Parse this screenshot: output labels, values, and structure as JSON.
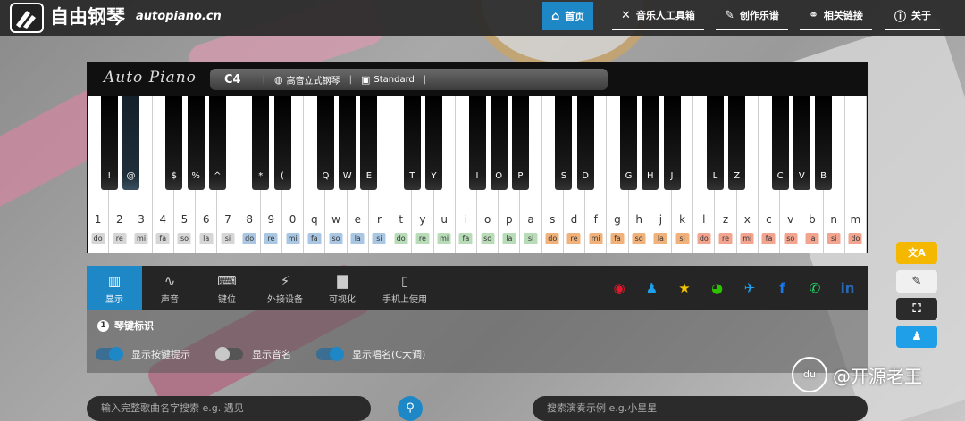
{
  "header": {
    "title": "自由钢琴",
    "domain": "autopiano.cn",
    "nav": [
      {
        "label": "首页",
        "icon": "home-icon",
        "active": true
      },
      {
        "label": "音乐人工具箱",
        "icon": "tools-icon",
        "active": false
      },
      {
        "label": "创作乐谱",
        "icon": "pen-icon",
        "active": false
      },
      {
        "label": "相关链接",
        "icon": "link-icon",
        "active": false
      },
      {
        "label": "关于",
        "icon": "info-icon",
        "active": false
      }
    ]
  },
  "piano": {
    "logo": "Auto Piano",
    "octave": "C4",
    "instrument": "高音立式钢琴",
    "layout": "Standard",
    "sep": "|",
    "white_keys": [
      {
        "key": "1",
        "sol": "do"
      },
      {
        "key": "2",
        "sol": "re"
      },
      {
        "key": "3",
        "sol": "mi"
      },
      {
        "key": "4",
        "sol": "fa"
      },
      {
        "key": "5",
        "sol": "so"
      },
      {
        "key": "6",
        "sol": "la"
      },
      {
        "key": "7",
        "sol": "si"
      },
      {
        "key": "8",
        "sol": "do"
      },
      {
        "key": "9",
        "sol": "re"
      },
      {
        "key": "0",
        "sol": "mi"
      },
      {
        "key": "q",
        "sol": "fa"
      },
      {
        "key": "w",
        "sol": "so"
      },
      {
        "key": "e",
        "sol": "la"
      },
      {
        "key": "r",
        "sol": "si"
      },
      {
        "key": "t",
        "sol": "do"
      },
      {
        "key": "y",
        "sol": "re"
      },
      {
        "key": "u",
        "sol": "mi"
      },
      {
        "key": "i",
        "sol": "fa"
      },
      {
        "key": "o",
        "sol": "so"
      },
      {
        "key": "p",
        "sol": "la"
      },
      {
        "key": "a",
        "sol": "si"
      },
      {
        "key": "s",
        "sol": "do"
      },
      {
        "key": "d",
        "sol": "re"
      },
      {
        "key": "f",
        "sol": "mi"
      },
      {
        "key": "g",
        "sol": "fa"
      },
      {
        "key": "h",
        "sol": "so"
      },
      {
        "key": "j",
        "sol": "la"
      },
      {
        "key": "k",
        "sol": "si"
      },
      {
        "key": "l",
        "sol": "do"
      },
      {
        "key": "z",
        "sol": "re"
      },
      {
        "key": "x",
        "sol": "mi"
      },
      {
        "key": "c",
        "sol": "fa"
      },
      {
        "key": "v",
        "sol": "so"
      },
      {
        "key": "b",
        "sol": "la"
      },
      {
        "key": "n",
        "sol": "si"
      },
      {
        "key": "m",
        "sol": "do"
      }
    ],
    "black_keys": [
      {
        "label": "!",
        "after": 0
      },
      {
        "label": "@",
        "after": 1,
        "pressed": true
      },
      {
        "label": "$",
        "after": 3
      },
      {
        "label": "%",
        "after": 4
      },
      {
        "label": "^",
        "after": 5
      },
      {
        "label": "*",
        "after": 7
      },
      {
        "label": "(",
        "after": 8
      },
      {
        "label": "Q",
        "after": 10
      },
      {
        "label": "W",
        "after": 11
      },
      {
        "label": "E",
        "after": 12
      },
      {
        "label": "T",
        "after": 14
      },
      {
        "label": "Y",
        "after": 15
      },
      {
        "label": "I",
        "after": 17
      },
      {
        "label": "O",
        "after": 18
      },
      {
        "label": "P",
        "after": 19
      },
      {
        "label": "S",
        "after": 21
      },
      {
        "label": "D",
        "after": 22
      },
      {
        "label": "G",
        "after": 24
      },
      {
        "label": "H",
        "after": 25
      },
      {
        "label": "J",
        "after": 26
      },
      {
        "label": "L",
        "after": 28
      },
      {
        "label": "Z",
        "after": 29
      },
      {
        "label": "C",
        "after": 31
      },
      {
        "label": "V",
        "after": 32
      },
      {
        "label": "B",
        "after": 33
      }
    ],
    "group_colors": [
      "#d6d6d6",
      "#a9c6e2",
      "#b8dcb8",
      "#f0b27a",
      "#f2a48f"
    ]
  },
  "toolbar": {
    "tabs": [
      {
        "label": "显示",
        "icon": "piano-icon",
        "active": true
      },
      {
        "label": "声音",
        "icon": "wave-icon",
        "active": false
      },
      {
        "label": "键位",
        "icon": "keyboard-icon",
        "active": false
      },
      {
        "label": "外接设备",
        "icon": "plug-icon",
        "active": false
      },
      {
        "label": "可视化",
        "icon": "bar-chart-icon",
        "active": false
      },
      {
        "label": "手机上使用",
        "icon": "phone-icon",
        "active": false
      }
    ],
    "social": [
      {
        "name": "weibo-icon",
        "glyph": "◉",
        "color": "#e6162d"
      },
      {
        "name": "qq-icon",
        "glyph": "♟",
        "color": "#1e9fe8"
      },
      {
        "name": "qzone-icon",
        "glyph": "★",
        "color": "#f5c400"
      },
      {
        "name": "wechat-icon",
        "glyph": "◕",
        "color": "#2dc100"
      },
      {
        "name": "twitter-icon",
        "glyph": "✈",
        "color": "#1da1f2"
      },
      {
        "name": "facebook-icon",
        "glyph": "f",
        "color": "#1877f2"
      },
      {
        "name": "whatsapp-icon",
        "glyph": "✆",
        "color": "#25d366"
      },
      {
        "name": "linkedin-icon",
        "glyph": "in",
        "color": "#2867b2"
      }
    ]
  },
  "settings": {
    "section_num": "1",
    "section_title": "琴键标识",
    "toggles": [
      {
        "label": "显示按键提示",
        "on": true
      },
      {
        "label": "显示音名",
        "on": false
      },
      {
        "label": "显示唱名(C大调)",
        "on": true
      }
    ]
  },
  "search": {
    "song_placeholder": "输入完整歌曲名字搜索  e.g. 遇见",
    "demo_placeholder": "搜索演奏示例  e.g.小星星"
  },
  "side_buttons": [
    {
      "name": "translate-button",
      "glyph": "文A",
      "color": "#f5b800"
    },
    {
      "name": "no-edit-button",
      "glyph": "✎",
      "color": "#f0f0f0"
    },
    {
      "name": "fullscreen-button",
      "glyph": "⛶",
      "color": "#2b2b2b"
    },
    {
      "name": "qq-button",
      "glyph": "♟",
      "color": "#1e9fe8"
    }
  ],
  "watermark": {
    "icon_text": "du",
    "text": "@开源老王"
  }
}
